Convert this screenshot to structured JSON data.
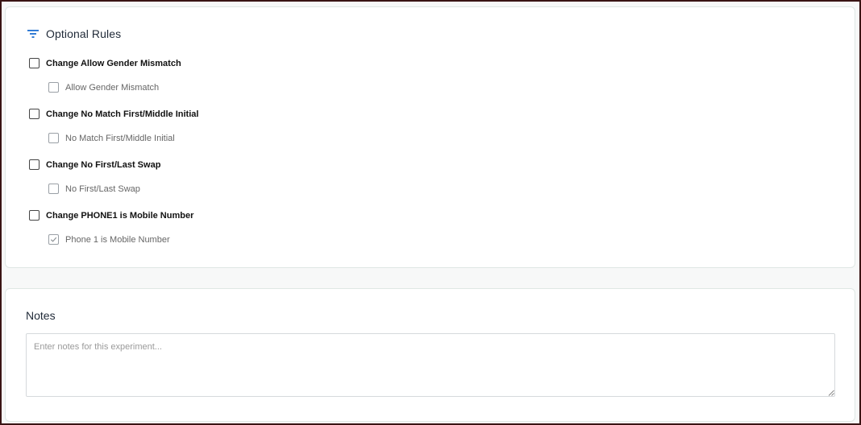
{
  "optional_rules": {
    "title": "Optional Rules",
    "icon": "filter-icon",
    "accent_color": "#1f6fd1",
    "rules": [
      {
        "label": "Change Allow Gender Mismatch",
        "checked": false,
        "sub_label": "Allow Gender Mismatch",
        "sub_checked": false
      },
      {
        "label": "Change No Match First/Middle Initial",
        "checked": false,
        "sub_label": "No Match First/Middle Initial",
        "sub_checked": false
      },
      {
        "label": "Change No First/Last Swap",
        "checked": false,
        "sub_label": "No First/Last Swap",
        "sub_checked": false
      },
      {
        "label": "Change PHONE1 is Mobile Number",
        "checked": false,
        "sub_label": "Phone 1 is Mobile Number",
        "sub_checked": true
      }
    ]
  },
  "notes": {
    "title": "Notes",
    "value": "",
    "placeholder": "Enter notes for this experiment..."
  }
}
